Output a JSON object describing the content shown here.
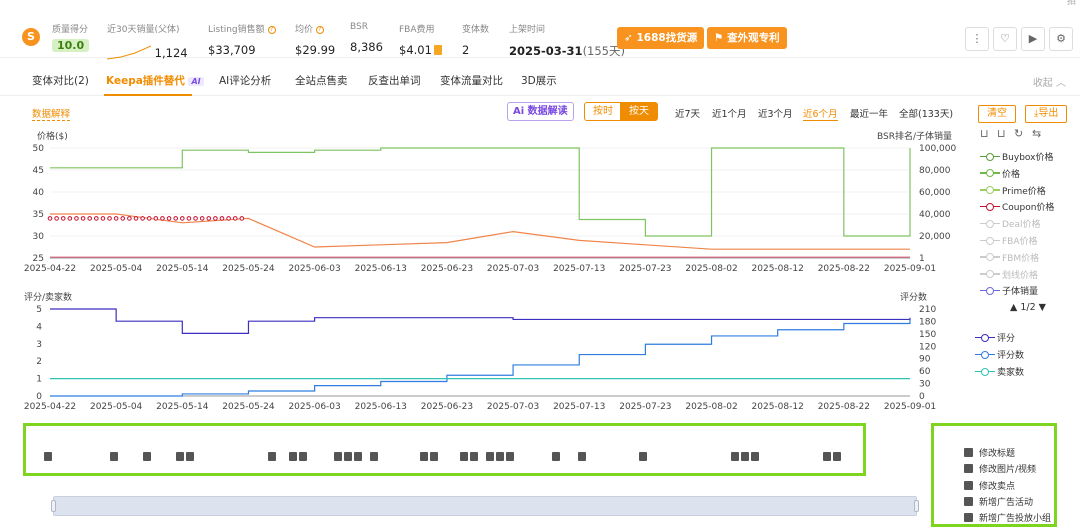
{
  "header": {
    "stats": [
      {
        "label": "质量得分",
        "value": "10.0"
      },
      {
        "label": "近30天销量(父体)",
        "value": "1,124"
      },
      {
        "label": "Listing销售额",
        "value": "$33,709"
      },
      {
        "label": "均价",
        "value": "$29.99"
      },
      {
        "label": "BSR",
        "value": "8,386"
      },
      {
        "label": "FBA费用",
        "value": "$4.01"
      },
      {
        "label": "变体数",
        "value": "2"
      },
      {
        "label": "上架时间",
        "value": "2025-03-31",
        "extra": "(155天)"
      }
    ],
    "btn_1688": "1688找货源",
    "btn_patent": "查外观专利"
  },
  "tabs": [
    "变体对比(2)",
    "Keepa插件替代",
    "AI评论分析",
    "全站点售卖",
    "反查出单词",
    "变体流量对比",
    "3D展示"
  ],
  "ai_badge": "AI",
  "fold": "收起",
  "toolbar": {
    "data_explain": "数据解释",
    "ai_read": "数据解读",
    "by_hour": "按时",
    "by_day": "按天",
    "ranges": [
      "近7天",
      "近1个月",
      "近3个月",
      "近6个月",
      "最近一年",
      "全部(133天)"
    ],
    "active_range": "近6个月",
    "clear": "清空",
    "export": "导出"
  },
  "chart1": {
    "ylabel_left": "价格($)",
    "ylabel_right": "BSR排名/子体销量",
    "y_ticks": [
      "50",
      "45",
      "40",
      "35",
      "30",
      "25"
    ],
    "y2_ticks": [
      "100,000",
      "80,000",
      "60,000",
      "40,000",
      "20,000",
      "1"
    ]
  },
  "chart2": {
    "ylabel_left": "评分/卖家数",
    "ylabel_right": "评分数",
    "y_ticks": [
      "5",
      "4",
      "3",
      "2",
      "1",
      "0"
    ],
    "y2_ticks": [
      "210",
      "180",
      "150",
      "120",
      "90",
      "60",
      "30",
      "0"
    ]
  },
  "x_ticks": [
    "2025-04-22",
    "2025-05-04",
    "2025-05-14",
    "2025-05-24",
    "2025-06-03",
    "2025-06-13",
    "2025-06-23",
    "2025-07-03",
    "2025-07-13",
    "2025-07-23",
    "2025-08-02",
    "2025-08-12",
    "2025-08-22",
    "2025-09-01"
  ],
  "legend1": [
    {
      "name": "Buybox价格",
      "color": "#5a9e3a",
      "on": true
    },
    {
      "name": "价格",
      "color": "#70b848",
      "on": true
    },
    {
      "name": "Prime价格",
      "color": "#9bd060",
      "on": true
    },
    {
      "name": "Coupon价格",
      "color": "#c8102e",
      "on": true
    },
    {
      "name": "Deal价格",
      "color": "#ccc",
      "on": false
    },
    {
      "name": "FBA价格",
      "color": "#ccc",
      "on": false
    },
    {
      "name": "FBM价格",
      "color": "#ccc",
      "on": false
    },
    {
      "name": "划线价格",
      "color": "#ccc",
      "on": false
    },
    {
      "name": "子体销量",
      "color": "#6a6ad8",
      "on": true
    }
  ],
  "legend_page": "▲ 1/2 ▼",
  "legend2": [
    {
      "name": "评分",
      "color": "#3b2fc0"
    },
    {
      "name": "评分数",
      "color": "#2f7de0"
    },
    {
      "name": "卖家数",
      "color": "#2ec4b6"
    }
  ],
  "event_legend": [
    {
      "glyph": "T",
      "name": "修改标题"
    },
    {
      "glyph": "▣",
      "name": "修改图片/视频"
    },
    {
      "glyph": "★",
      "name": "修改卖点"
    },
    {
      "glyph": "AD",
      "name": "新增广告活动"
    },
    {
      "glyph": "a",
      "name": "新增广告投放小组"
    }
  ],
  "chart_data": [
    {
      "type": "line",
      "title": "",
      "xlabel": "",
      "ylabel": "价格($)",
      "x": [
        "2025-04-22",
        "2025-05-04",
        "2025-05-14",
        "2025-05-24",
        "2025-06-03",
        "2025-06-13",
        "2025-06-23",
        "2025-07-03",
        "2025-07-13",
        "2025-07-23",
        "2025-08-02",
        "2025-08-12",
        "2025-08-22",
        "2025-09-01"
      ],
      "series": [
        {
          "name": "价格",
          "values": [
            35,
            35,
            33,
            34,
            27.5,
            28,
            28.5,
            31,
            29,
            28,
            27,
            27,
            27,
            27
          ]
        },
        {
          "name": "Coupon价格",
          "values": [
            34,
            34,
            34,
            34,
            null,
            null,
            null,
            null,
            null,
            null,
            null,
            null,
            null,
            null
          ]
        },
        {
          "name": "Buybox价格",
          "values": [
            25.2,
            25.2,
            25.2,
            25.2,
            25.2,
            25.2,
            25.2,
            25.2,
            25.2,
            25.2,
            25.2,
            25.2,
            25.2,
            25.2
          ]
        },
        {
          "name": "BSR排名",
          "values": [
            82000,
            82000,
            98000,
            96000,
            98000,
            100000,
            100000,
            100000,
            35000,
            20000,
            100000,
            100000,
            20000,
            100000
          ]
        }
      ],
      "ylim": [
        25,
        50
      ]
    },
    {
      "type": "line",
      "title": "",
      "ylabel": "评分/卖家数",
      "x": [
        "2025-04-22",
        "2025-05-04",
        "2025-05-14",
        "2025-05-24",
        "2025-06-03",
        "2025-06-13",
        "2025-06-23",
        "2025-07-03",
        "2025-07-13",
        "2025-07-23",
        "2025-08-02",
        "2025-08-12",
        "2025-08-22",
        "2025-09-01"
      ],
      "series": [
        {
          "name": "评分",
          "values": [
            5,
            4.3,
            3.6,
            4.3,
            4.5,
            4.5,
            4.5,
            4.4,
            4.4,
            4.4,
            4.4,
            4.4,
            4.4,
            4.5
          ]
        },
        {
          "name": "评分数",
          "values": [
            0,
            0,
            5,
            12,
            25,
            35,
            50,
            75,
            100,
            125,
            145,
            160,
            175,
            185
          ]
        },
        {
          "name": "卖家数",
          "values": [
            1,
            1,
            1,
            1,
            1,
            1,
            1,
            1,
            1,
            1,
            1,
            1,
            1,
            1
          ]
        }
      ],
      "ylim": [
        0,
        5
      ],
      "y2lim": [
        0,
        210
      ]
    }
  ]
}
